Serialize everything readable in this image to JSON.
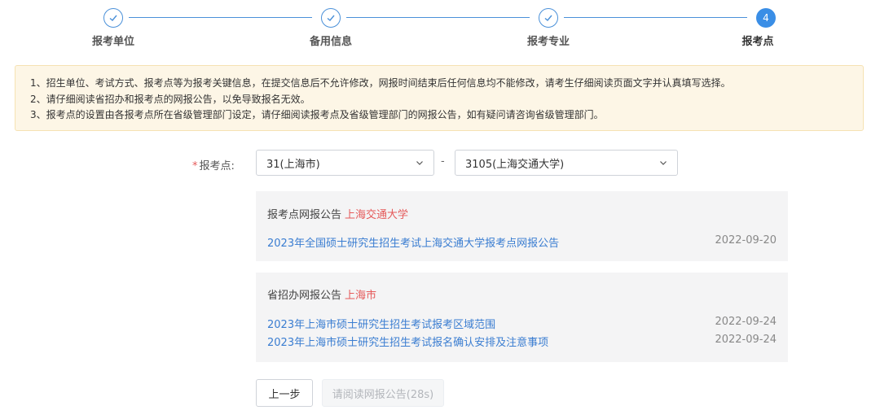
{
  "steps": [
    {
      "label": "报考单位",
      "status": "done"
    },
    {
      "label": "备用信息",
      "status": "done"
    },
    {
      "label": "报考专业",
      "status": "done"
    },
    {
      "label": "报考点",
      "status": "active",
      "number": "4"
    }
  ],
  "notice": {
    "lines": [
      "1、招生单位、考试方式、报考点等为报考关键信息，在提交信息后不允许修改，网报时间结束后任何信息均不能修改，请考生仔细阅读页面文字并认真填写选择。",
      "2、请仔细阅读省招办和报考点的网报公告，以免导致报名无效。",
      "3、报考点的设置由各报考点所在省级管理部门设定，请仔细阅读报考点及省级管理部门的网报公告，如有疑问请咨询省级管理部门。"
    ]
  },
  "form": {
    "required_mark": "*",
    "label": "报考点:",
    "province_value": "31(上海市)",
    "separator": "-",
    "site_value": "3105(上海交通大学)"
  },
  "site_panel": {
    "title": "报考点网报公告",
    "highlight": "上海交通大学",
    "items": [
      {
        "text": "2023年全国硕士研究生招生考试上海交通大学报考点网报公告",
        "date": "2022-09-20"
      }
    ]
  },
  "province_panel": {
    "title": "省招办网报公告",
    "highlight": "上海市",
    "items": [
      {
        "text": "2023年上海市硕士研究生招生考试报考区域范围",
        "date": "2022-09-24"
      },
      {
        "text": "2023年上海市硕士研究生招生考试报名确认安排及注意事项",
        "date": "2022-09-24"
      }
    ]
  },
  "buttons": {
    "prev_label": "上一步",
    "next_label": "请阅读网报公告(28s)"
  },
  "colors": {
    "accent": "#3a8ee6",
    "link": "#3a7dd1",
    "highlight": "#e55a5a",
    "notice_bg": "#fdf6e6"
  }
}
